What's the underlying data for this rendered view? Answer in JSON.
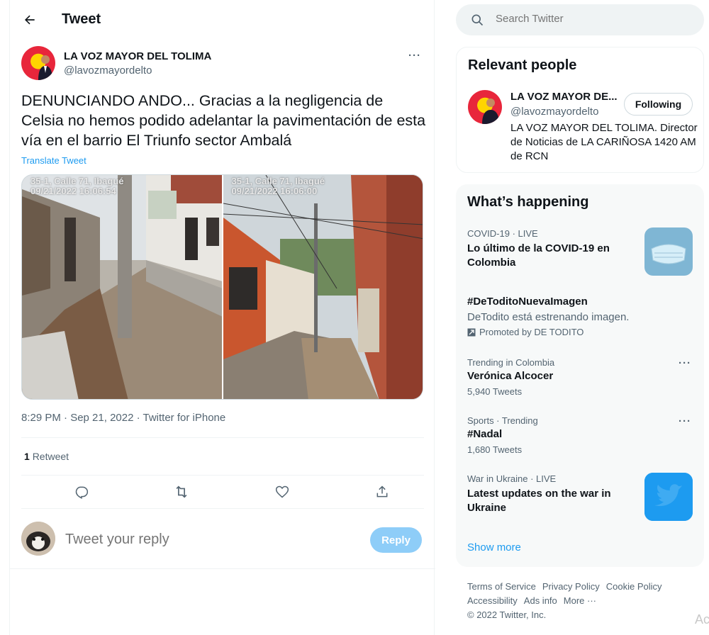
{
  "header": {
    "title": "Tweet"
  },
  "tweet": {
    "author_name": "LA VOZ MAYOR DEL TOLIMA",
    "author_handle": "@lavozmayordelto",
    "text": "DENUNCIANDO ANDO... Gracias a la negligencia de Celsia no hemos podido adelantar la pavimentación de esta vía en el barrio El Triunfo sector Ambalá",
    "translate_label": "Translate Tweet",
    "photo_stamps": [
      {
        "line1": "35-1, Calle 71, Ibagué",
        "line2": "09/21/2022 16:06:54"
      },
      {
        "line1": "35-1, Calle 71, Ibagué",
        "line2": "09/21/2022 16:06:00"
      }
    ],
    "meta": "8:29 PM · Sep 21, 2022 · Twitter for iPhone",
    "retweet_count": "1",
    "retweet_label": "Retweet"
  },
  "reply": {
    "placeholder": "Tweet your reply",
    "button": "Reply"
  },
  "sidebar": {
    "search_placeholder": "Search Twitter",
    "relevant": {
      "title": "Relevant people",
      "name": "LA VOZ MAYOR DE...",
      "handle": "@lavozmayordelto",
      "follow_label": "Following",
      "bio": "LA VOZ MAYOR DEL TOLIMA. Director de Noticias de LA CARIÑOSA 1420 AM de RCN"
    },
    "trends": {
      "title": "What’s happening",
      "items": [
        {
          "context": "COVID-19 · LIVE",
          "headline": "Lo último de la COVID-19 en Colombia"
        },
        {
          "headline": "#DeToditoNuevaImagen",
          "description": "DeTodito está estrenando imagen.",
          "promoted": "Promoted by DE TODITO"
        },
        {
          "context": "Trending in Colombia",
          "headline": "Verónica Alcocer",
          "count": "5,940 Tweets"
        },
        {
          "context": "Sports · Trending",
          "headline": "#Nadal",
          "count": "1,680 Tweets"
        },
        {
          "context": "War in Ukraine · LIVE",
          "headline": "Latest updates on the war in Ukraine"
        }
      ],
      "show_more": "Show more"
    },
    "footer": {
      "links": [
        "Terms of Service",
        "Privacy Policy",
        "Cookie Policy",
        "Accessibility",
        "Ads info",
        "More ···"
      ],
      "copyright": "© 2022 Twitter, Inc."
    }
  },
  "colors": {
    "accent": "#1d9bf0",
    "reply_disabled": "#8ecdf8",
    "text": "#0f1419",
    "muted": "#536471"
  }
}
